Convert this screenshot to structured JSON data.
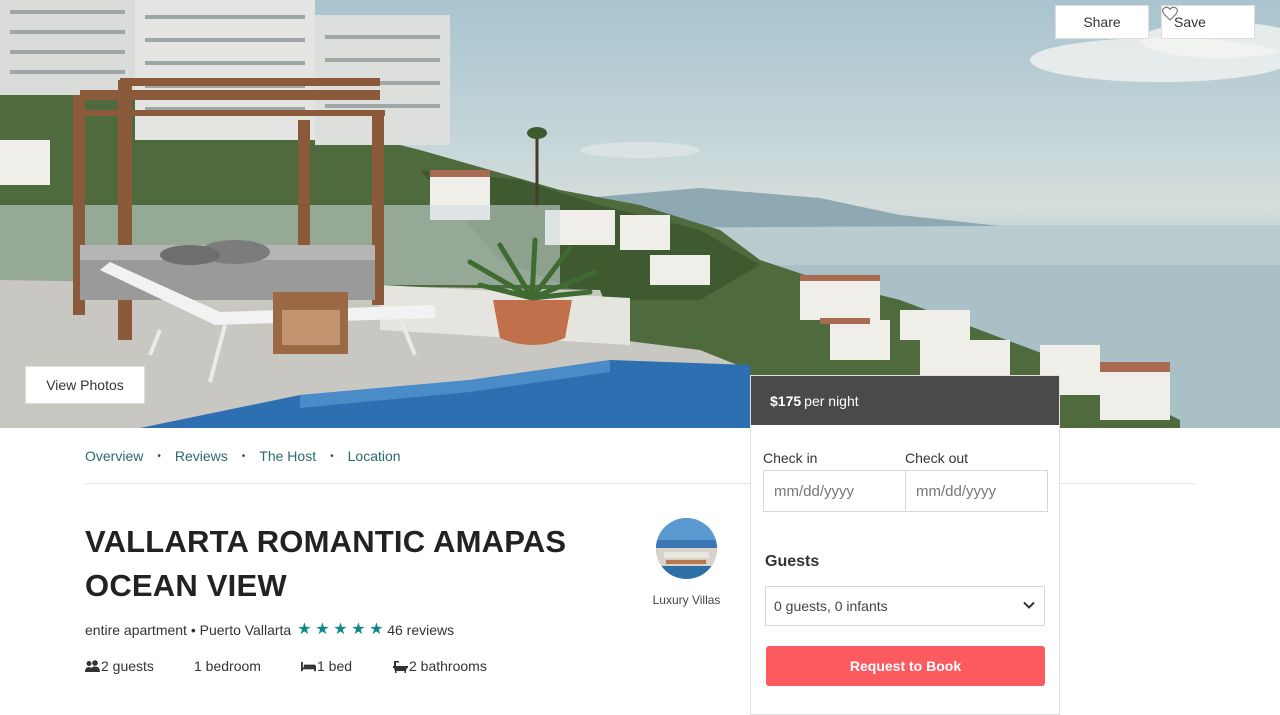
{
  "hero": {
    "share_label": "Share",
    "save_label": "Save",
    "view_photos_label": "View Photos",
    "heart_icon": "heart-outline-icon"
  },
  "nav": {
    "items": [
      "Overview",
      "Reviews",
      "The Host",
      "Location"
    ]
  },
  "listing": {
    "title": "VALLARTA ROMANTIC AMAPAS OCEAN VIEW",
    "type_location": "entire apartment • Puerto Vallarta",
    "rating": 5,
    "reviews": "46 reviews",
    "star_color": "#0e8a8a",
    "facts": {
      "guests": "2 guests",
      "bedroom": "1 bedroom",
      "bed": "1 bed",
      "bathrooms": "2 bathrooms"
    }
  },
  "host": {
    "name": "Luxury Villas"
  },
  "booking": {
    "price": "$175",
    "per_night": "per night",
    "check_in_label": "Check in",
    "check_out_label": "Check out",
    "check_in_placeholder": "mm/dd/yyyy",
    "check_out_placeholder": "mm/dd/yyyy",
    "guests_label": "Guests",
    "guests_value": "0 guests, 0 infants",
    "request_label": "Request to Book",
    "accent_color": "#fb5a5f",
    "header_color": "#4a4a4a"
  }
}
